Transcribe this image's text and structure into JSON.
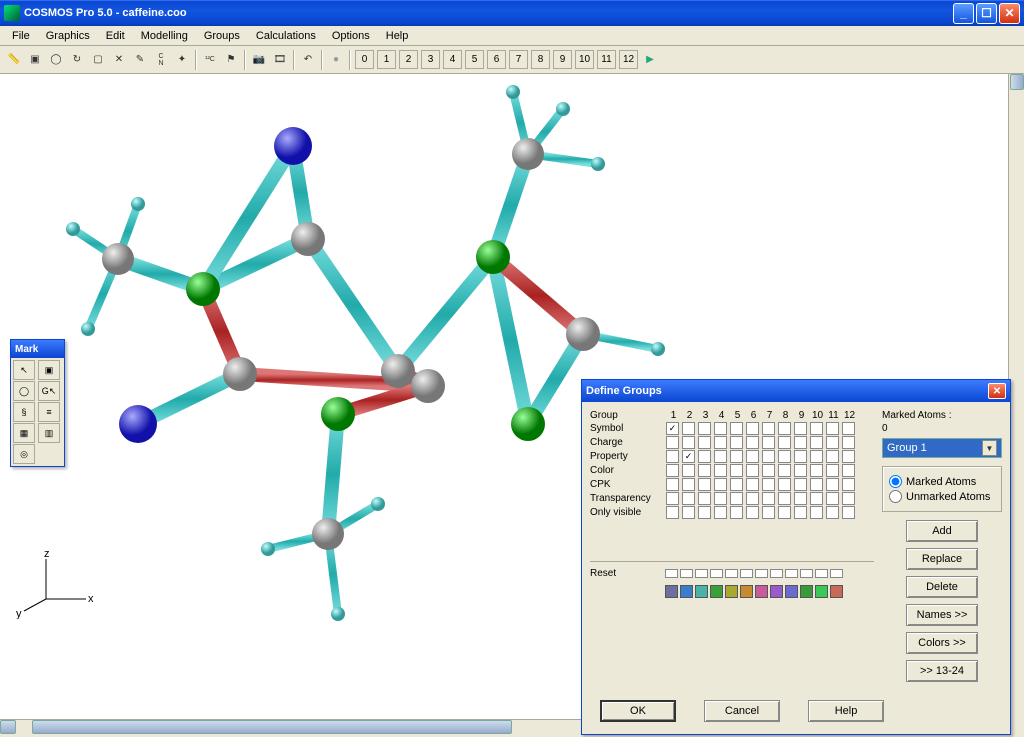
{
  "app": {
    "title": "COSMOS Pro 5.0 - caffeine.coo"
  },
  "menu": [
    "File",
    "Graphics",
    "Edit",
    "Modelling",
    "Groups",
    "Calculations",
    "Options",
    "Help"
  ],
  "toolbar": {
    "group_nums": [
      "0",
      "1",
      "2",
      "3",
      "4",
      "5",
      "6",
      "7",
      "8",
      "9",
      "10",
      "11",
      "12"
    ]
  },
  "markwin": {
    "title": "Mark"
  },
  "axes": {
    "x": "x",
    "y": "y",
    "z": "z"
  },
  "dialog": {
    "title": "Define Groups",
    "labels": {
      "group": "Group",
      "rows": [
        "Symbol",
        "Charge",
        "Property",
        "Color",
        "CPK",
        "Transparency",
        "Only visible"
      ],
      "reset": "Reset"
    },
    "headers": [
      "1",
      "2",
      "3",
      "4",
      "5",
      "6",
      "7",
      "8",
      "9",
      "10",
      "11",
      "12"
    ],
    "checked": {
      "symbol": [
        1
      ],
      "property": [
        2
      ]
    },
    "marked": {
      "label": "Marked Atoms :",
      "count": "0"
    },
    "combo": "Group 1",
    "radios": {
      "marked": "Marked Atoms",
      "unmarked": "Unmarked Atoms"
    },
    "buttons": {
      "add": "Add",
      "replace": "Replace",
      "delete": "Delete",
      "names": "Names >>",
      "colors": "Colors >>",
      "range": ">> 13-24",
      "ok": "OK",
      "cancel": "Cancel",
      "help": "Help"
    },
    "palette": [
      "#6d6f9e",
      "#3a7ecb",
      "#4ab3a8",
      "#3aa03a",
      "#a8a832",
      "#c88a2e",
      "#c85a9e",
      "#9a5acb",
      "#6a6ad0",
      "#3a9a3a",
      "#3ac85a",
      "#c86a5a"
    ]
  }
}
